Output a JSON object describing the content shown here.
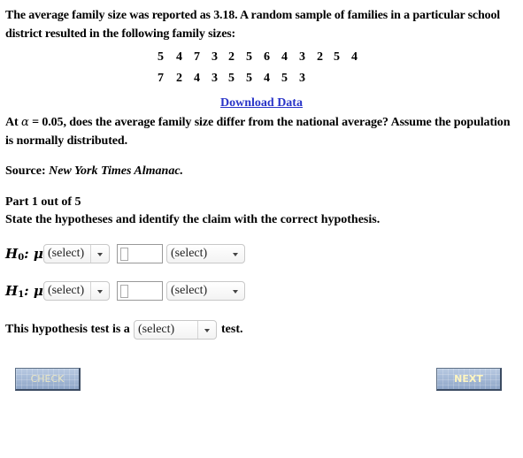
{
  "problem": {
    "intro": "The average family size was reported as 3.18. A random sample of families in a particular school district resulted in the following family sizes:",
    "data_row_1": [
      "5",
      "4",
      "7",
      "3",
      "2",
      "5",
      "6",
      "4",
      "3",
      "2",
      "5",
      "4"
    ],
    "data_row_2": [
      "7",
      "2",
      "4",
      "3",
      "5",
      "5",
      "4",
      "5",
      "3"
    ],
    "download_link": "Download Data",
    "question_prefix": "At ",
    "alpha_symbol": "α",
    "question_rest": " = 0.05, does the average family size differ from the national average? Assume the population is normally distributed.",
    "source_label": "Source: ",
    "source_value": "New York Times Almanac."
  },
  "part": {
    "label": "Part 1 out of 5",
    "instruction": "State the hypotheses and identify the claim with the correct hypothesis."
  },
  "hypotheses": [
    {
      "name": "H",
      "subscript": "0",
      "param": ": μ",
      "operator_select": "(select)",
      "value_input": "",
      "claim_select": "(select)"
    },
    {
      "name": "H",
      "subscript": "1",
      "param": ": μ",
      "operator_select": "(select)",
      "value_input": "",
      "claim_select": "(select)"
    }
  ],
  "test_type": {
    "prefix": "This hypothesis test is a",
    "select": "(select)",
    "suffix": "test."
  },
  "buttons": {
    "check": "CHECK",
    "next": "NEXT"
  }
}
